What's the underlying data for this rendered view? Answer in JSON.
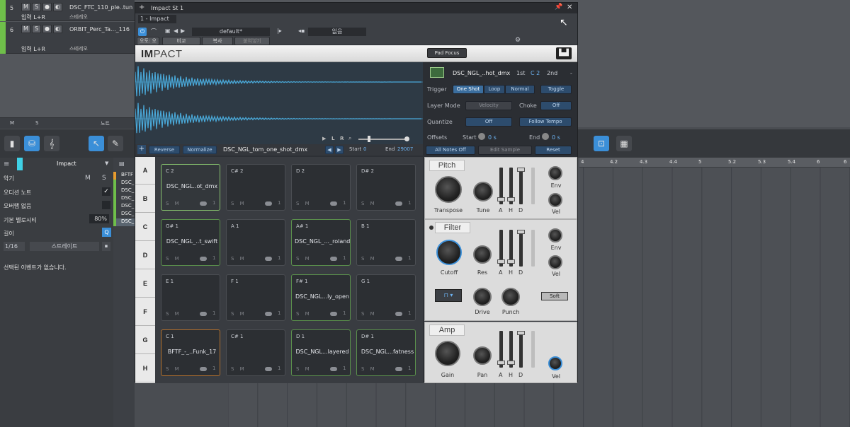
{
  "tracks": [
    {
      "num": "5",
      "name": "DSC_FTC_110_ple..tun",
      "input": "",
      "mode": "",
      "color": "#6fbf4a"
    },
    {
      "num": "6",
      "name": "ORBIT_Perc_Ta..._116",
      "input": "입력 L+R",
      "mode": "스테레오",
      "color": "#6fbf4a"
    }
  ],
  "track5_input": "입력 L+R",
  "track5_mode": "스테레오",
  "mute_label": "M",
  "solo_label": "S",
  "left_strip": {
    "m": "M",
    "s": "S",
    "notes": "노트"
  },
  "inspector": {
    "track_name": "Impact",
    "instrument": "악기",
    "audition_notes": "오디션 노트",
    "overlap": "오버랩 없음",
    "default_velocity_label": "기본 벨로시티",
    "default_velocity_value": "80%",
    "length_label": "길이",
    "quantize_value": "1/16",
    "straight": "스트레이트",
    "no_event": "선택된 이벤트가 없습니다.",
    "event_items": [
      "BFTF",
      "DSC_",
      "DSC_",
      "DSC_",
      "DSC_",
      "DSC_",
      "DSC_"
    ]
  },
  "ruler": [
    "4",
    "4.2",
    "4.3",
    "4.4",
    "5",
    "5.2",
    "5.3",
    "5.4",
    "6",
    "6"
  ],
  "plugin": {
    "title": "Impact St 1",
    "preset_slot": "1 - Impact",
    "preset_name": "default*",
    "none_label": "없음",
    "auto_off": "오토: 오프",
    "compare": "비교",
    "copy": "복사",
    "paste": "붙여넣기",
    "logo_a": "IM",
    "logo_b": "PACT",
    "pad_focus": "Pad Focus"
  },
  "wave_bar": {
    "reverse": "Reverse",
    "normalize": "Normalize",
    "sample": "DSC_NGL_tom_one_shot_dmx",
    "start_label": "Start",
    "start_value": "0",
    "end_label": "End",
    "end_value": "29007"
  },
  "sample_info": {
    "name": "DSC_NGL_..hot_dmx",
    "first": "1st",
    "note": "C 2",
    "second": "2nd",
    "dash": "-",
    "trigger": "Trigger",
    "one_shot": "One Shot",
    "loop": "Loop",
    "normal": "Normal",
    "toggle": "Toggle",
    "layer_mode": "Layer Mode",
    "velocity": "Velocity",
    "choke": "Choke",
    "choke_val": "Off",
    "quantize": "Quantize",
    "quantize_val": "Off",
    "follow_tempo": "Follow Tempo",
    "offsets": "Offsets",
    "start": "Start",
    "start_val": "0 s",
    "end": "End",
    "end_val": "0 s",
    "all_notes_off": "All Notes Off",
    "edit_sample": "Edit Sample",
    "reset": "Reset"
  },
  "bank_letters": [
    "A",
    "B",
    "C",
    "D",
    "E",
    "F",
    "G",
    "H"
  ],
  "pads": [
    {
      "note": "C 2",
      "name": "DSC_NGL..ot_dmx",
      "state": "sel"
    },
    {
      "note": "C# 2",
      "name": "",
      "state": ""
    },
    {
      "note": "D 2",
      "name": "",
      "state": ""
    },
    {
      "note": "D# 2",
      "name": "",
      "state": ""
    },
    {
      "note": "G# 1",
      "name": "DSC_NGL_..t_swift",
      "state": "green"
    },
    {
      "note": "A 1",
      "name": "",
      "state": ""
    },
    {
      "note": "A# 1",
      "name": "DSC_NGL_..._roland",
      "state": "green"
    },
    {
      "note": "B 1",
      "name": "",
      "state": ""
    },
    {
      "note": "E 1",
      "name": "",
      "state": ""
    },
    {
      "note": "F 1",
      "name": "",
      "state": ""
    },
    {
      "note": "F# 1",
      "name": "DSC_NGL...ly_open",
      "state": "green"
    },
    {
      "note": "G 1",
      "name": "",
      "state": ""
    },
    {
      "note": "C 1",
      "name": "BFTF_-_..Funk_17",
      "state": "orange"
    },
    {
      "note": "C# 1",
      "name": "",
      "state": ""
    },
    {
      "note": "D 1",
      "name": "DSC_NGL...layered",
      "state": "green"
    },
    {
      "note": "D# 1",
      "name": "DSC_NGL...fatness",
      "state": "green"
    }
  ],
  "pad_sm": "S M",
  "pad_one": "1",
  "pitch": {
    "title": "Pitch",
    "transpose": "Transpose",
    "tune": "Tune",
    "env": "Env",
    "vel": "Vel",
    "a": "A",
    "h": "H",
    "d": "D"
  },
  "filter": {
    "title": "Filter",
    "cutoff": "Cutoff",
    "res": "Res",
    "env": "Env",
    "vel": "Vel",
    "drive": "Drive",
    "punch": "Punch",
    "soft": "Soft",
    "a": "A",
    "h": "H",
    "d": "D"
  },
  "amp": {
    "title": "Amp",
    "gain": "Gain",
    "pan": "Pan",
    "vel": "Vel",
    "a": "A",
    "h": "H",
    "d": "D"
  },
  "colors": {
    "accent": "#3b8fd8",
    "track_green": "#6fbf4a",
    "wave": "#4aa9d9"
  }
}
